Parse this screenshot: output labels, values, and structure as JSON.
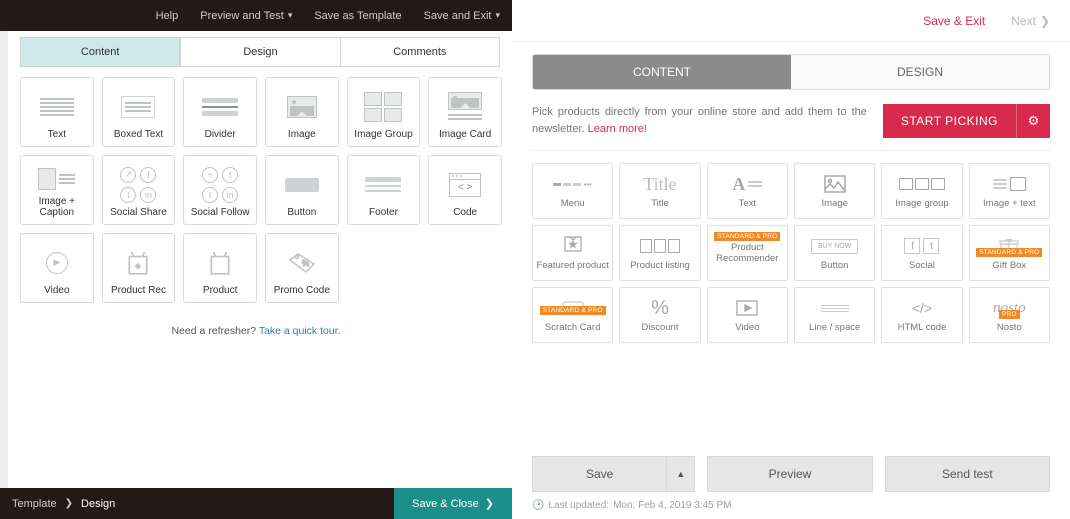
{
  "left": {
    "top_menu": {
      "help": "Help",
      "preview": "Preview and Test",
      "save_template": "Save as Template",
      "save_exit": "Save and Exit"
    },
    "tabs": {
      "content": "Content",
      "design": "Design",
      "comments": "Comments"
    },
    "blocks": [
      {
        "label": "Text"
      },
      {
        "label": "Boxed Text"
      },
      {
        "label": "Divider"
      },
      {
        "label": "Image"
      },
      {
        "label": "Image Group"
      },
      {
        "label": "Image Card"
      },
      {
        "label": "Image + Caption"
      },
      {
        "label": "Social Share"
      },
      {
        "label": "Social Follow"
      },
      {
        "label": "Button"
      },
      {
        "label": "Footer"
      },
      {
        "label": "Code"
      },
      {
        "label": "Video"
      },
      {
        "label": "Product Rec"
      },
      {
        "label": "Product"
      },
      {
        "label": "Promo Code"
      }
    ],
    "refresher_text": "Need a refresher? ",
    "refresher_link": "Take a quick tour",
    "footer": {
      "template": "Template",
      "design": "Design",
      "save_close": "Save & Close"
    }
  },
  "right": {
    "top": {
      "save_exit": "Save & Exit",
      "next": "Next"
    },
    "tabs": {
      "content": "CONTENT",
      "design": "DESIGN"
    },
    "info": {
      "text": "Pick products directly from your online store and add them to the newsletter. ",
      "learn_more": "Learn more!"
    },
    "pick": {
      "label": "START PICKING"
    },
    "badge": "STANDARD & PRO",
    "buy_now": "BUY NOW",
    "blocks": [
      {
        "label": "Menu"
      },
      {
        "label": "Title"
      },
      {
        "label": "Text"
      },
      {
        "label": "Image"
      },
      {
        "label": "Image group"
      },
      {
        "label": "Image + text"
      },
      {
        "label": "Featured product"
      },
      {
        "label": "Product listing"
      },
      {
        "label": "Product Recommender"
      },
      {
        "label": "Button"
      },
      {
        "label": "Social"
      },
      {
        "label": "Gift Box"
      },
      {
        "label": "Scratch Card"
      },
      {
        "label": "Discount"
      },
      {
        "label": "Video"
      },
      {
        "label": "Line / space"
      },
      {
        "label": "HTML code"
      },
      {
        "label": "Nosto"
      }
    ],
    "actions": {
      "save": "Save",
      "preview": "Preview",
      "send_test": "Send test"
    },
    "status": {
      "label": "Last updated:",
      "ts": "Mon, Feb 4, 2019 3:45 PM"
    }
  }
}
